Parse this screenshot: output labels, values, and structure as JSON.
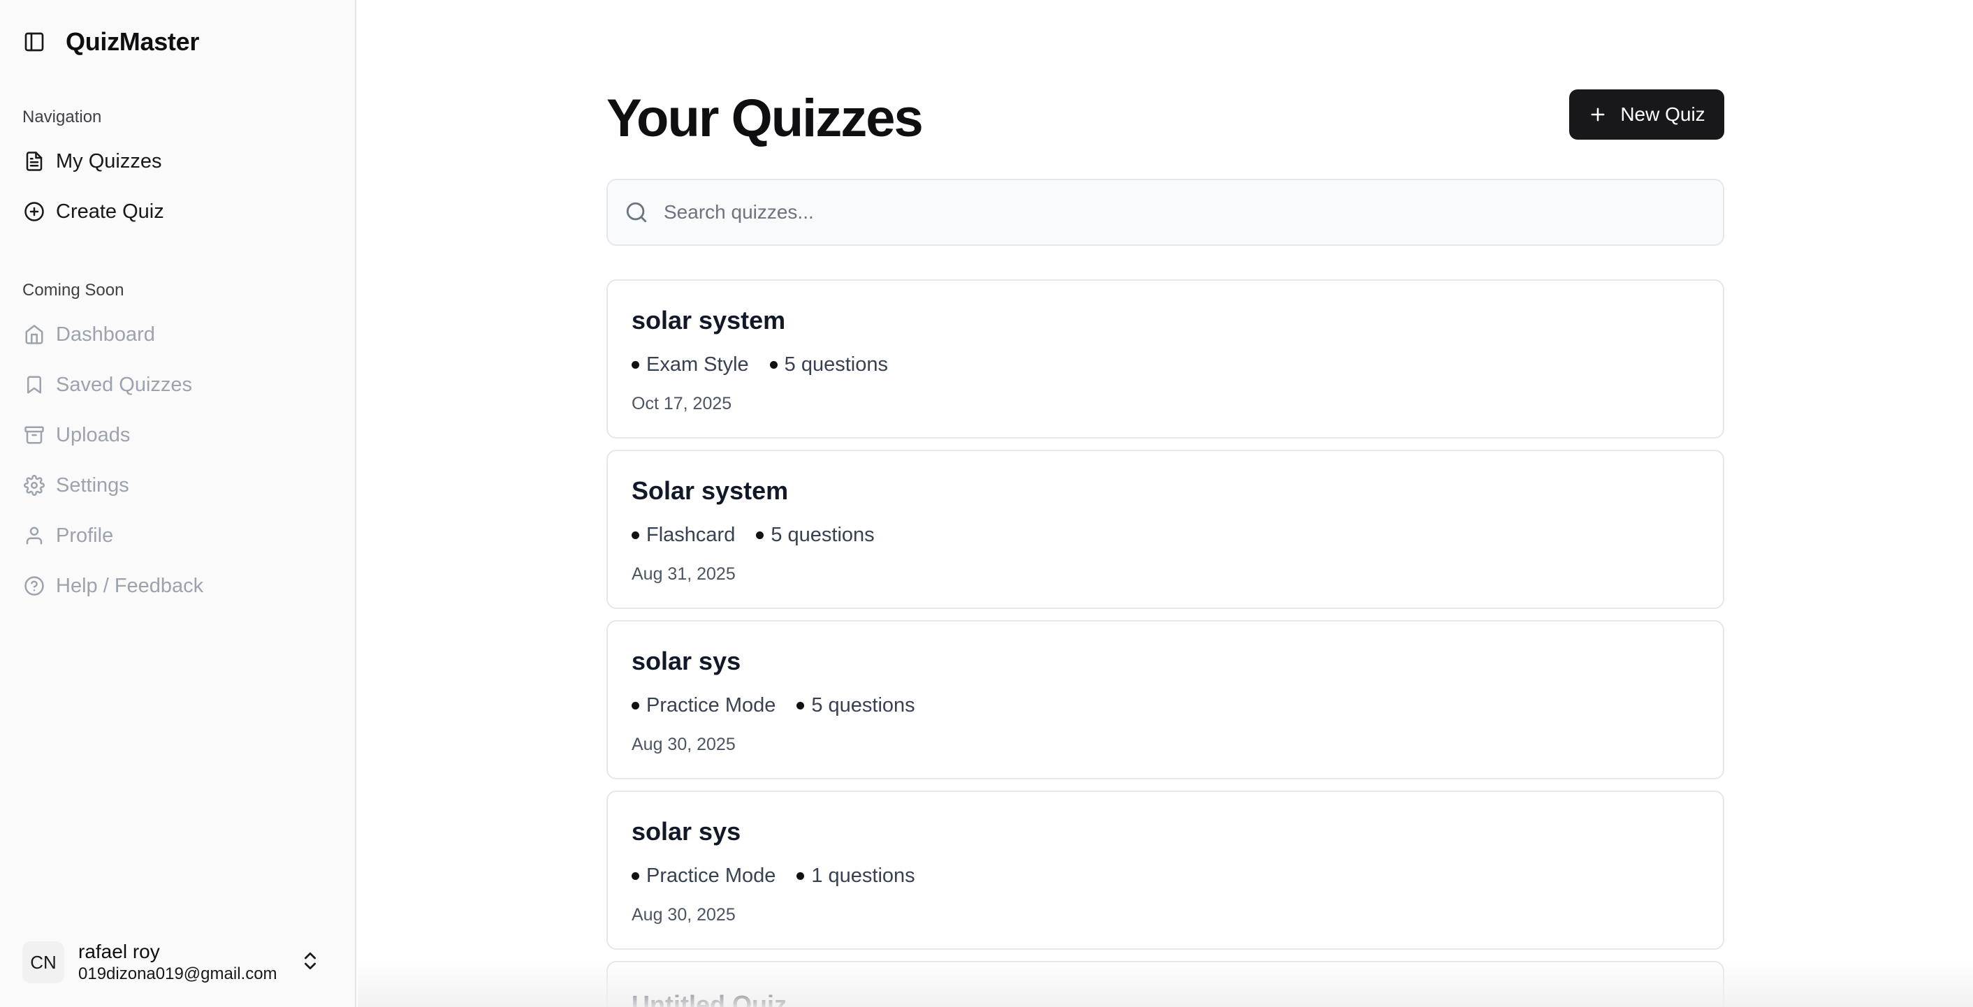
{
  "app": {
    "name": "QuizMaster"
  },
  "sidebar": {
    "toggle_icon": "sidebar-toggle-icon",
    "navigation_title": "Navigation",
    "nav_items": [
      {
        "label": "My Quizzes",
        "icon": "file-text-icon"
      },
      {
        "label": "Create Quiz",
        "icon": "plus-circle-icon"
      }
    ],
    "coming_soon_title": "Coming Soon",
    "coming_soon_items": [
      {
        "label": "Dashboard",
        "icon": "home-icon"
      },
      {
        "label": "Saved Quizzes",
        "icon": "bookmark-icon"
      },
      {
        "label": "Uploads",
        "icon": "archive-icon"
      },
      {
        "label": "Settings",
        "icon": "gear-icon"
      },
      {
        "label": "Profile",
        "icon": "user-icon"
      },
      {
        "label": "Help / Feedback",
        "icon": "help-circle-icon"
      }
    ],
    "user": {
      "initials": "CN",
      "name": "rafael roy",
      "email": "019dizona019@gmail.com"
    }
  },
  "main": {
    "title": "Your Quizzes",
    "new_quiz_label": "New Quiz",
    "search_placeholder": "Search quizzes...",
    "quizzes": [
      {
        "title": "solar system",
        "mode": "Exam Style",
        "questions": "5 questions",
        "date": "Oct 17, 2025"
      },
      {
        "title": "Solar system",
        "mode": "Flashcard",
        "questions": "5 questions",
        "date": "Aug 31, 2025"
      },
      {
        "title": "solar sys",
        "mode": "Practice Mode",
        "questions": "5 questions",
        "date": "Aug 30, 2025"
      },
      {
        "title": "solar sys",
        "mode": "Practice Mode",
        "questions": "1 questions",
        "date": "Aug 30, 2025"
      },
      {
        "title": "Untitled Quiz"
      }
    ]
  },
  "colors": {
    "accent": "#18181b",
    "muted": "#9ca3af",
    "sidebar_bg": "#fafafa"
  }
}
